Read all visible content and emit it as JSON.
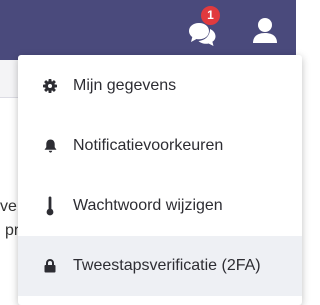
{
  "header": {
    "notification_count": "1",
    "bg_color": "#4a4a7c"
  },
  "background_text": {
    "line1": "ve",
    "line2": "pr"
  },
  "user_menu": {
    "items": [
      {
        "label": "Mijn gegevens",
        "icon": "gear-icon"
      },
      {
        "label": "Notificatievoorkeuren",
        "icon": "bell-icon"
      },
      {
        "label": "Wachtwoord wijzigen",
        "icon": "thermometer-icon"
      },
      {
        "label": "Tweestapsverificatie (2FA)",
        "icon": "lock-icon",
        "highlighted": true
      }
    ]
  }
}
